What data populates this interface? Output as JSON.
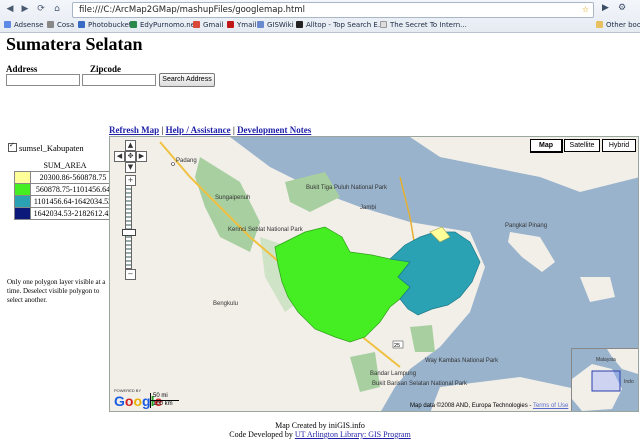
{
  "browser": {
    "url": "file:///C:/ArcMap2GMap/mashupFiles/googlemap.html",
    "bookmarks": [
      "Adsense",
      "Cosa",
      "Photobucket",
      "EdyPurnomo.net",
      "Gmail",
      "Ymail",
      "GISWiki",
      "Alltop - Top Search E...",
      "The Secret To Intern...",
      "Other book"
    ]
  },
  "page": {
    "title": "Sumatera Selatan",
    "address_label": "Address",
    "zipcode_label": "Zipcode",
    "address_value": "",
    "zipcode_value": "",
    "search_button": "Search Address"
  },
  "links": {
    "refresh": "Refresh Map",
    "help": "Help / Assistance",
    "dev": "Development Notes",
    "separator": "|"
  },
  "legend": {
    "layer_name": "sumsel_Kabupaten",
    "field": "SUM_AREA",
    "classes": [
      {
        "color": "#ffff99",
        "label": "20300.86-560878.75"
      },
      {
        "color": "#44ee22",
        "label": "560878.75-1101456.64"
      },
      {
        "color": "#2aa2b4",
        "label": "1101456.64-1642034.53"
      },
      {
        "color": "#0b1a7a",
        "label": "1642034.53-2182612.42"
      }
    ]
  },
  "note": "Only one polygon layer visible at a time. Deselect visible polygon to select another.",
  "map": {
    "types": [
      "Map",
      "Satellite",
      "Hybrid"
    ],
    "selected_type": "Map",
    "copyright": "Map data ©2008 AND, Europa Technologies -",
    "terms": "Terms of Use",
    "powered": "POWERED BY",
    "google": "Google",
    "scale_mi": "50 mi",
    "scale_km": "100 km",
    "places": [
      {
        "name": "Padang",
        "kind": "city"
      },
      {
        "name": "Sungaipenuh",
        "kind": "town"
      },
      {
        "name": "Bukit Tiga Puluh National Park",
        "kind": "park"
      },
      {
        "name": "Kerinci Seblat National Park",
        "kind": "park"
      },
      {
        "name": "Bengkulu",
        "kind": "city"
      },
      {
        "name": "Bandar Lampung",
        "kind": "city"
      },
      {
        "name": "Bukit Barisan Selatan National Park",
        "kind": "park"
      },
      {
        "name": "Way Kambas National Park",
        "kind": "park"
      },
      {
        "name": "Jambi",
        "kind": "city"
      },
      {
        "name": "Pangkal Pinang",
        "kind": "city"
      }
    ],
    "inset_places": [
      "Malaysia",
      "Indo"
    ]
  },
  "footer": {
    "line1": "Map Created by iniGIS.info",
    "line2_prefix": "Code Developed by",
    "line2_link": "UT Arlington Library: GIS Program"
  }
}
